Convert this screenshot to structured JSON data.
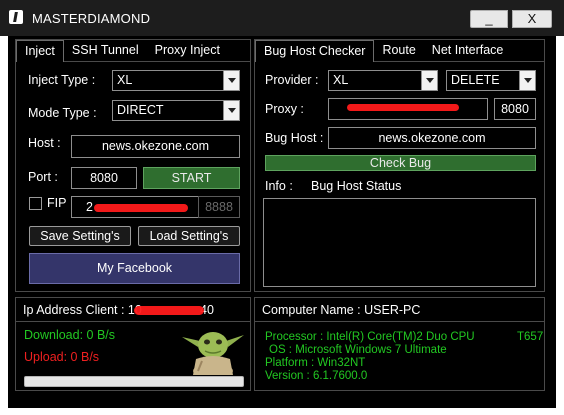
{
  "window": {
    "title": "MASTERDIAMOND",
    "minimize_label": "_",
    "close_label": "X"
  },
  "left_panel": {
    "tabs": [
      {
        "label": "Inject",
        "active": true
      },
      {
        "label": "SSH Tunnel",
        "active": false
      },
      {
        "label": "Proxy Inject",
        "active": false
      }
    ],
    "inject_type_label": "Inject Type :",
    "inject_type_value": "XL",
    "mode_type_label": "Mode Type :",
    "mode_type_value": "DIRECT",
    "host_label": "Host :",
    "host_value": "news.okezone.com",
    "port_label": "Port :",
    "port_value": "8080",
    "start_label": "START",
    "fip_label": "FIP",
    "fip_ip_value": "2",
    "fip_port_value": "8888",
    "save_settings_label": "Save Setting's",
    "load_settings_label": "Load Setting's",
    "facebook_label": "My Facebook"
  },
  "right_panel": {
    "tabs": [
      {
        "label": "Bug Host Checker",
        "active": true
      },
      {
        "label": "Route",
        "active": false
      },
      {
        "label": "Net Interface",
        "active": false
      }
    ],
    "provider_label": "Provider :",
    "provider_value": "XL",
    "action_value": "DELETE",
    "proxy_label": "Proxy :",
    "proxy_value": "",
    "proxy_port_value": "8080",
    "bug_host_label": "Bug Host :",
    "bug_host_value": "news.okezone.com",
    "check_bug_label": "Check Bug",
    "info_label": "Info :",
    "info_value": "Bug Host Status"
  },
  "status_left": {
    "ip_label": "Ip Address Client : 10",
    "ip_tail": "40",
    "download_text": "Download: 0 B/s",
    "upload_text": "Upload: 0 B/s",
    "progress_fraction": 0.0
  },
  "status_right": {
    "computer_name_text": "Computer Name : USER-PC",
    "processor_text": "Processor : Intel(R) Core(TM)2 Duo CPU",
    "processor_model": "T657",
    "os_text": "OS : Microsoft Windows 7 Ultimate",
    "platform_text": "Platform : Win32NT",
    "version_text": "Version : 6.1.7600.0"
  },
  "colors": {
    "accent_green": "#2f6e2f",
    "status_green": "#22c822",
    "status_red": "#ee2020",
    "facebook_blue": "#34356a",
    "redaction_red": "#ff1a1a"
  },
  "icons": [
    "app-icon",
    "dropdown-arrow-icon",
    "yoda-mascot-icon"
  ]
}
